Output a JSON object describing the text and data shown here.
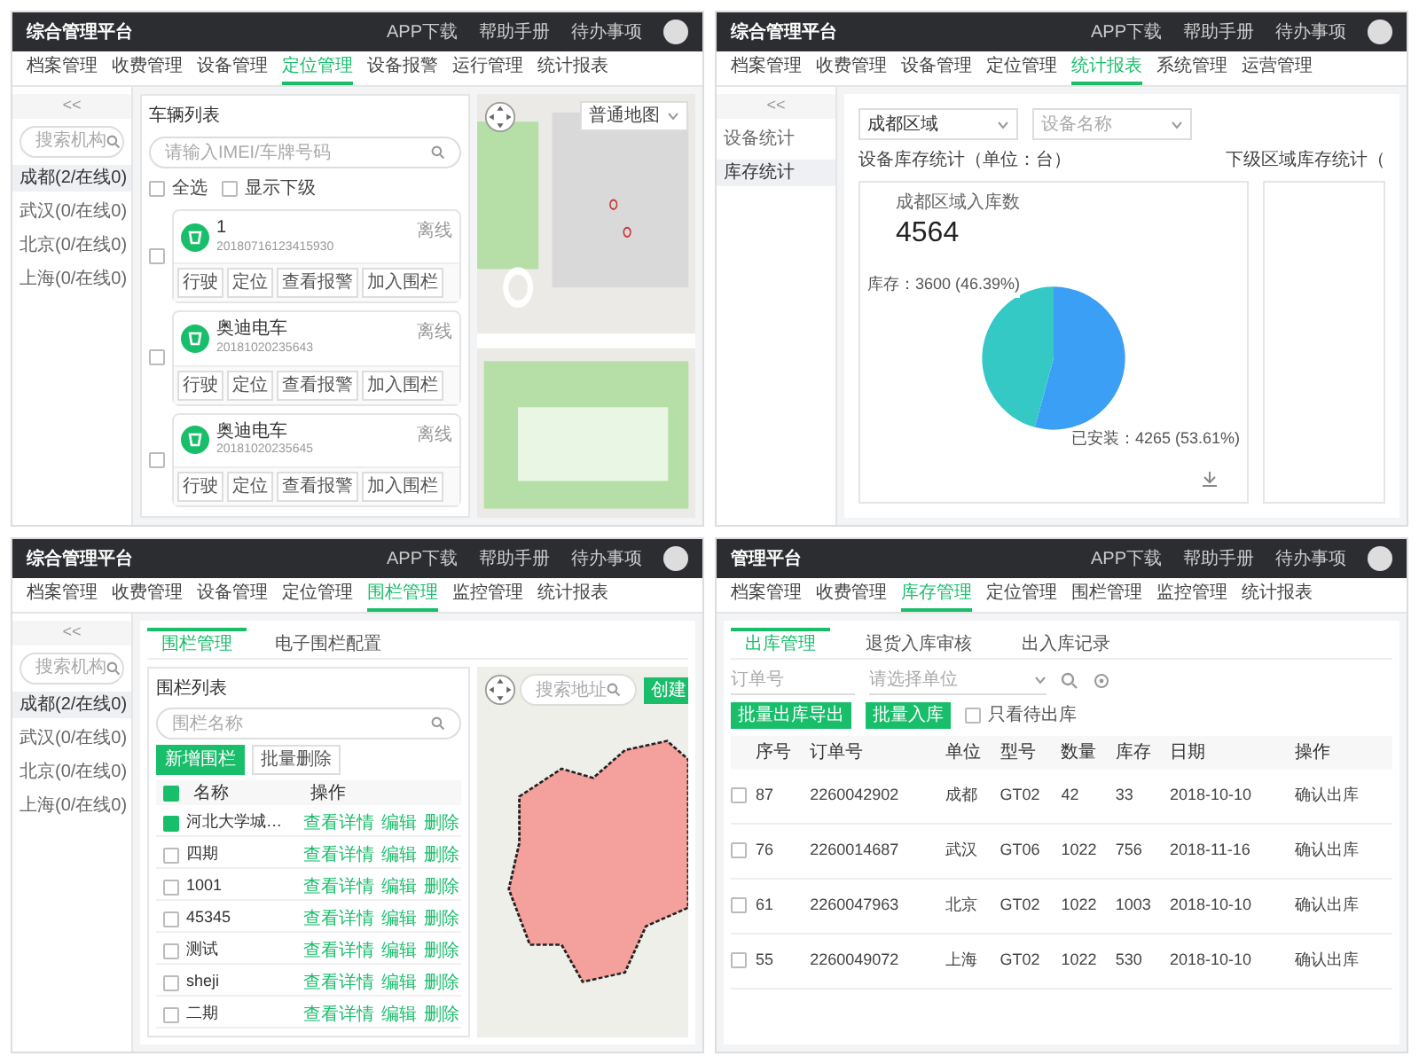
{
  "location_screen": {
    "header": {
      "title": "综合管理平台",
      "links": [
        "APP下载",
        "帮助手册",
        "待办事项"
      ]
    },
    "nav": [
      {
        "label": "档案管理",
        "selected": false
      },
      {
        "label": "收费管理",
        "selected": false
      },
      {
        "label": "设备管理",
        "selected": false
      },
      {
        "label": "定位管理",
        "selected": true
      },
      {
        "label": "设备报警",
        "selected": false
      },
      {
        "label": "运行管理",
        "selected": false
      },
      {
        "label": "统计报表",
        "selected": false
      }
    ],
    "sidebar": {
      "collapse": "<<",
      "search_placeholder": "搜索机构",
      "items": [
        {
          "label": "成都(2/在线0)",
          "selected": true
        },
        {
          "label": "武汉(0/在线0)",
          "selected": false
        },
        {
          "label": "北京(0/在线0)",
          "selected": false
        },
        {
          "label": "上海(0/在线0)",
          "selected": false
        }
      ]
    },
    "vehicle_list": {
      "title": "车辆列表",
      "search_placeholder": "请输入IMEI/车牌号码",
      "select_all": {
        "label": "全选",
        "checked": false
      },
      "show_sub": {
        "label": "显示下级",
        "checked": false
      },
      "vehicles": [
        {
          "name": "1",
          "imei": "20180716123415930",
          "status": "离线",
          "checked": false,
          "actions": [
            "行驶",
            "定位",
            "查看报警",
            "加入围栏"
          ]
        },
        {
          "name": "奥迪电车",
          "imei": "20181020235643",
          "status": "离线",
          "checked": false,
          "actions": [
            "行驶",
            "定位",
            "查看报警",
            "加入围栏"
          ]
        },
        {
          "name": "奥迪电车",
          "imei": "20181020235645",
          "status": "离线",
          "checked": false,
          "actions": [
            "行驶",
            "定位",
            "查看报警",
            "加入围栏"
          ]
        }
      ]
    },
    "map": {
      "map_type": "普通地图"
    }
  },
  "statistics_screen": {
    "header": {
      "title": "综合管理平台",
      "links": [
        "APP下载",
        "帮助手册",
        "待办事项"
      ]
    },
    "nav": [
      {
        "label": "档案管理",
        "selected": false
      },
      {
        "label": "收费管理",
        "selected": false
      },
      {
        "label": "设备管理",
        "selected": false
      },
      {
        "label": "定位管理",
        "selected": false
      },
      {
        "label": "统计报表",
        "selected": true
      },
      {
        "label": "系统管理",
        "selected": false
      },
      {
        "label": "运营管理",
        "selected": false
      }
    ],
    "sidebar": {
      "collapse": "<<",
      "items": [
        {
          "label": "设备统计",
          "selected": false
        },
        {
          "label": "库存统计",
          "selected": true
        }
      ]
    },
    "filters": [
      {
        "value": "成都区域"
      },
      {
        "placeholder": "设备名称"
      }
    ],
    "chart_title": "设备库存统计（单位：台）",
    "side_title": "下级区域库存统计（",
    "total_label": "成都区域入库数",
    "total": "4564",
    "chart_data": {
      "type": "pie",
      "categories": [
        "已安装",
        "库存"
      ],
      "values": [
        4265,
        3600
      ],
      "colors": [
        "#3b9ff5",
        "#35c9c6"
      ],
      "value_labels": [
        "：4265 (53.61%)",
        "：3600 (46.39%)"
      ]
    }
  },
  "fence_screen": {
    "header": {
      "title": "综合管理平台",
      "links": [
        "APP下载",
        "帮助手册",
        "待办事项"
      ]
    },
    "nav": [
      {
        "label": "档案管理",
        "selected": false
      },
      {
        "label": "收费管理",
        "selected": false
      },
      {
        "label": "设备管理",
        "selected": false
      },
      {
        "label": "定位管理",
        "selected": false
      },
      {
        "label": "围栏管理",
        "selected": true
      },
      {
        "label": "监控管理",
        "selected": false
      },
      {
        "label": "统计报表",
        "selected": false
      }
    ],
    "sidebar": {
      "collapse": "<<",
      "search_placeholder": "搜索机构",
      "items": [
        {
          "label": "成都(2/在线0)",
          "selected": true
        },
        {
          "label": "武汉(0/在线0)",
          "selected": false
        },
        {
          "label": "北京(0/在线0)",
          "selected": false
        },
        {
          "label": "上海(0/在线0)",
          "selected": false
        }
      ]
    },
    "tabs": [
      {
        "label": "围栏管理",
        "selected": true
      },
      {
        "label": "电子围栏配置",
        "selected": false
      }
    ],
    "fence_list": {
      "title": "围栏列表",
      "search_placeholder": "围栏名称",
      "buttons": [
        "新增围栏",
        "批量删除"
      ],
      "columns": [
        "名称",
        "操作"
      ],
      "all_checked": true,
      "rows": [
        {
          "name": "河北大学城…",
          "checked": true,
          "actions": [
            "查看详情",
            "编辑",
            "删除"
          ]
        },
        {
          "name": "四期",
          "checked": false,
          "actions": [
            "查看详情",
            "编辑",
            "删除"
          ]
        },
        {
          "name": "1001",
          "checked": false,
          "actions": [
            "查看详情",
            "编辑",
            "删除"
          ]
        },
        {
          "name": "45345",
          "checked": false,
          "actions": [
            "查看详情",
            "编辑",
            "删除"
          ]
        },
        {
          "name": "测试",
          "checked": false,
          "actions": [
            "查看详情",
            "编辑",
            "删除"
          ]
        },
        {
          "name": "sheji",
          "checked": false,
          "actions": [
            "查看详情",
            "编辑",
            "删除"
          ]
        },
        {
          "name": "二期",
          "checked": false,
          "actions": [
            "查看详情",
            "编辑",
            "删除"
          ]
        }
      ]
    },
    "map": {
      "search_placeholder": "搜索地址",
      "button": "创建"
    }
  },
  "inventory_screen": {
    "header": {
      "title": "管理平台",
      "links": [
        "APP下载",
        "帮助手册",
        "待办事项"
      ]
    },
    "nav": [
      {
        "label": "档案管理",
        "selected": false
      },
      {
        "label": "收费管理",
        "selected": false
      },
      {
        "label": "库存管理",
        "selected": true
      },
      {
        "label": "定位管理",
        "selected": false
      },
      {
        "label": "围栏管理",
        "selected": false
      },
      {
        "label": "监控管理",
        "selected": false
      },
      {
        "label": "统计报表",
        "selected": false
      }
    ],
    "tabs": [
      {
        "label": "出库管理",
        "selected": true
      },
      {
        "label": "退货入库审核",
        "selected": false
      },
      {
        "label": "出入库记录",
        "selected": false
      }
    ],
    "filters": {
      "order_placeholder": "订单号",
      "unit_placeholder": "请选择单位"
    },
    "buttons": [
      "批量出库导出",
      "批量入库"
    ],
    "only_pending": {
      "label": "只看待出库",
      "checked": false
    },
    "table": {
      "columns": [
        "序号",
        "订单号",
        "单位",
        "型号",
        "数量",
        "库存",
        "日期",
        "操作"
      ],
      "rows": [
        {
          "checked": false,
          "cells": [
            "87",
            "2260042902",
            "成都",
            "GT02",
            "42",
            "33",
            "2018-10-10",
            "确认出库"
          ]
        },
        {
          "checked": false,
          "cells": [
            "76",
            "2260014687",
            "武汉",
            "GT06",
            "1022",
            "756",
            "2018-11-16",
            "确认出库"
          ]
        },
        {
          "checked": false,
          "cells": [
            "61",
            "2260047963",
            "北京",
            "GT02",
            "1022",
            "1003",
            "2018-10-10",
            "确认出库"
          ]
        },
        {
          "checked": false,
          "cells": [
            "55",
            "2260049072",
            "上海",
            "GT02",
            "1022",
            "530",
            "2018-10-10",
            "确认出库"
          ]
        }
      ]
    }
  }
}
